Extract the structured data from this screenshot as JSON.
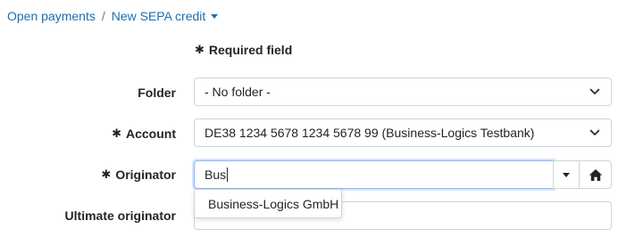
{
  "breadcrumb": {
    "parent": "Open payments",
    "separator": "/",
    "current": "New SEPA credit"
  },
  "form": {
    "required_note": "Required field",
    "asterisk": "✱",
    "folder": {
      "label": "Folder",
      "value": "- No folder -"
    },
    "account": {
      "label": "Account",
      "value": "DE38 1234 5678 1234 5678 99 (Business-Logics Testbank)"
    },
    "originator": {
      "label": "Originator",
      "value": "Bus",
      "suggestion": "Business-Logics GmbH"
    },
    "ultimate_originator": {
      "label": "Ultimate originator",
      "value": ""
    }
  },
  "icons": {
    "breadcrumb_caret": "caret-down-icon",
    "select_chevron": "chevron-down-icon",
    "originator_dropdown": "caret-down-icon",
    "originator_home": "home-icon"
  },
  "colors": {
    "link": "#1a6fb0",
    "focus_border": "#86b7fe",
    "border": "#ced4da",
    "text": "#212529"
  }
}
